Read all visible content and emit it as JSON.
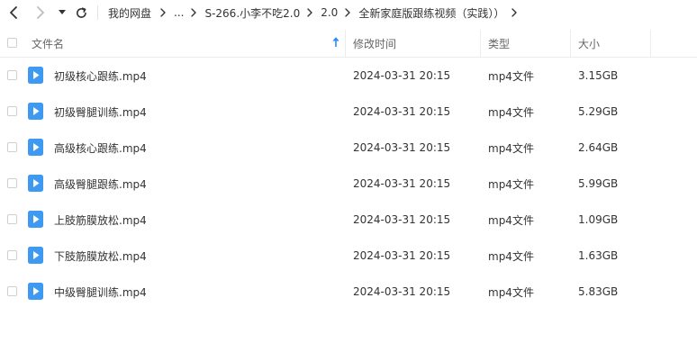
{
  "breadcrumb": {
    "items": [
      "我的网盘",
      "...",
      "S-266.小李不吃2.0",
      "2.0",
      "全新家庭版跟练视频（实践））"
    ]
  },
  "columns": {
    "name": "文件名",
    "modified": "修改时间",
    "type": "类型",
    "size": "大小"
  },
  "colors": {
    "accent": "#2f8cf2",
    "icon": "#3d9af0",
    "header_text": "#666666"
  },
  "files": [
    {
      "name": "初级核心跟练.mp4",
      "modified": "2024-03-31 20:15",
      "type": "mp4文件",
      "size": "3.15GB"
    },
    {
      "name": "初级臀腿训练.mp4",
      "modified": "2024-03-31 20:15",
      "type": "mp4文件",
      "size": "5.29GB"
    },
    {
      "name": "高级核心跟练.mp4",
      "modified": "2024-03-31 20:15",
      "type": "mp4文件",
      "size": "2.64GB"
    },
    {
      "name": "高级臀腿跟练.mp4",
      "modified": "2024-03-31 20:15",
      "type": "mp4文件",
      "size": "5.99GB"
    },
    {
      "name": "上肢筋膜放松.mp4",
      "modified": "2024-03-31 20:15",
      "type": "mp4文件",
      "size": "1.09GB"
    },
    {
      "name": "下肢筋膜放松.mp4",
      "modified": "2024-03-31 20:15",
      "type": "mp4文件",
      "size": "1.63GB"
    },
    {
      "name": "中级臀腿训练.mp4",
      "modified": "2024-03-31 20:15",
      "type": "mp4文件",
      "size": "5.83GB"
    }
  ]
}
